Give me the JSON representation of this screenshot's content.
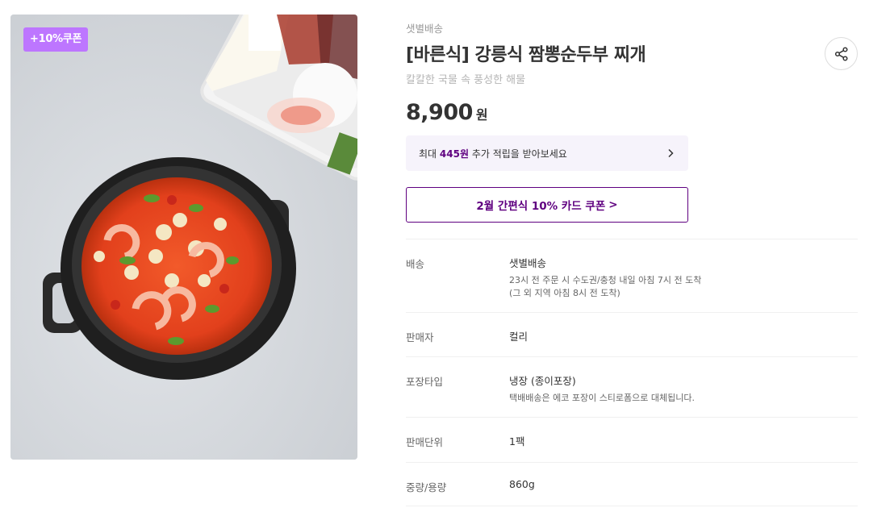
{
  "image": {
    "badge": "+10%쿠폰"
  },
  "product": {
    "delivery_tag": "샛별배송",
    "title": "[바른식] 강릉식 짬뽕순두부 찌개",
    "subtitle": "칼칼한 국물 속 풍성한 해물",
    "price": "8,900",
    "price_unit": "원",
    "share_icon": "share-icon"
  },
  "points": {
    "prefix": "최대 ",
    "amount": "445원",
    "suffix": " 추가 적립을 받아보세요"
  },
  "card_coupon": {
    "label": "2월 간편식 10% 카드 쿠폰",
    "chevron": ">"
  },
  "spec": [
    {
      "label": "배송",
      "value": "샛별배송",
      "sub": [
        "23시 전 주문 시 수도권/충청 내일 아침 7시 전 도착",
        "(그 외 지역 아침 8시 전 도착)"
      ]
    },
    {
      "label": "판매자",
      "value": "컬리"
    },
    {
      "label": "포장타입",
      "value": "냉장 (종이포장)",
      "sub": [
        "택배배송은 에코 포장이 스티로폼으로 대체됩니다."
      ]
    },
    {
      "label": "판매단위",
      "value": "1팩"
    },
    {
      "label": "중량/용량",
      "value": "860g"
    }
  ],
  "colors": {
    "accent": "#5f0080",
    "badge": "#bd76ff",
    "points_bg": "#f6f3fb"
  }
}
